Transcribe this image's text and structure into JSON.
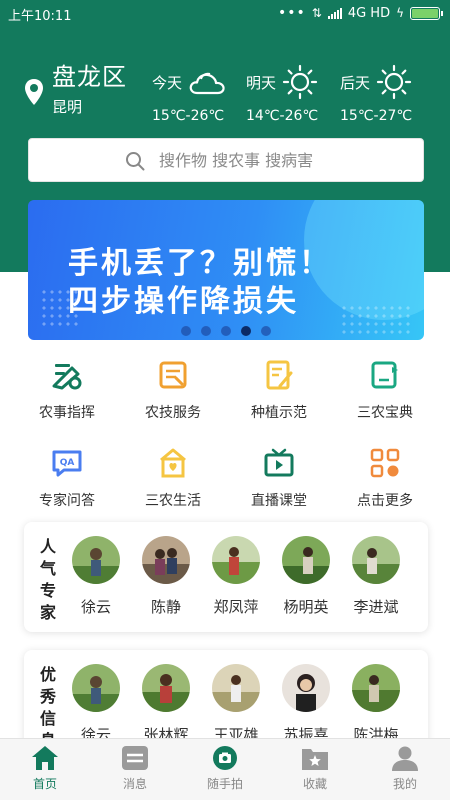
{
  "status_bar": {
    "time": "上午10:11",
    "network": "4G HD",
    "battery_level": 1.0
  },
  "location": {
    "district": "盘龙区",
    "city": "昆明"
  },
  "weather": [
    {
      "day": "今天",
      "icon": "cloudy-icon",
      "temp": "15℃-26℃"
    },
    {
      "day": "明天",
      "icon": "sunny-icon",
      "temp": "14℃-26℃"
    },
    {
      "day": "后天",
      "icon": "sunny-icon",
      "temp": "15℃-27℃"
    }
  ],
  "search": {
    "placeholder": "搜作物 搜农事 搜病害"
  },
  "banner": {
    "line1": "手机丢了？别慌！",
    "line2": "四步操作降损失",
    "pages": 5,
    "active_page": 4
  },
  "menu": [
    {
      "label": "农事指挥",
      "icon": "farm-command-icon",
      "color": "#137a5d"
    },
    {
      "label": "农技服务",
      "icon": "tech-service-icon",
      "color": "#f0a030"
    },
    {
      "label": "种植示范",
      "icon": "planting-demo-icon",
      "color": "#f5c542"
    },
    {
      "label": "三农宝典",
      "icon": "handbook-icon",
      "color": "#1aa782"
    },
    {
      "label": "专家问答",
      "icon": "qa-icon",
      "color": "#4a7df0"
    },
    {
      "label": "三农生活",
      "icon": "rural-life-icon",
      "color": "#f5c542"
    },
    {
      "label": "直播课堂",
      "icon": "live-class-icon",
      "color": "#137a5d"
    },
    {
      "label": "点击更多",
      "icon": "more-icon",
      "color": "#f08a3c"
    }
  ],
  "experts_card": {
    "title": "人气专家",
    "people": [
      "徐云",
      "陈静",
      "郑凤萍",
      "杨明英",
      "李进斌"
    ]
  },
  "informants_card": {
    "title": "优秀信息员",
    "people": [
      "徐云",
      "张林辉",
      "王亚雄",
      "苏振喜",
      "陈洪梅"
    ]
  },
  "tabs": [
    {
      "label": "首页",
      "icon": "home-icon",
      "active": true
    },
    {
      "label": "消息",
      "icon": "message-icon",
      "active": false
    },
    {
      "label": "随手拍",
      "icon": "camera-icon",
      "active": false
    },
    {
      "label": "收藏",
      "icon": "favorite-icon",
      "active": false
    },
    {
      "label": "我的",
      "icon": "profile-icon",
      "active": false
    }
  ],
  "colors": {
    "brand": "#137a5d",
    "banner_start": "#2b6cf0",
    "banner_end": "#36c6f6"
  }
}
